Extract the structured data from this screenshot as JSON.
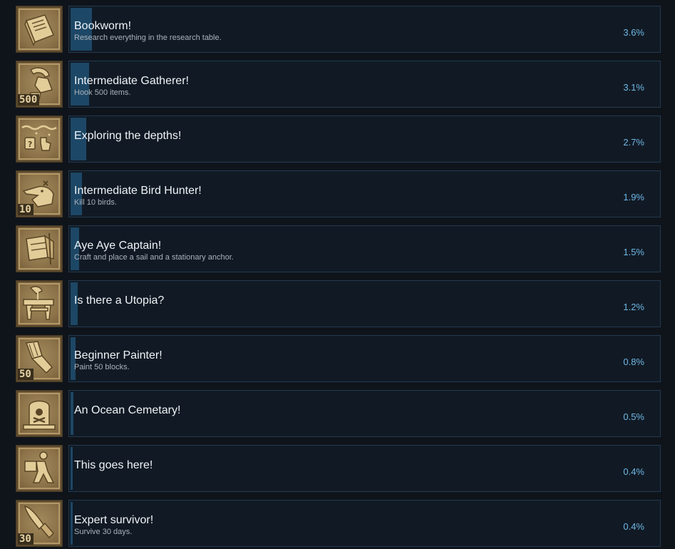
{
  "achievements": [
    {
      "title": "Bookworm!",
      "description": "Research everything in the research table.",
      "percent": "3.6%",
      "percent_value": 3.6,
      "icon": "book-icon",
      "count": ""
    },
    {
      "title": "Intermediate Gatherer!",
      "description": "Hook 500 items.",
      "percent": "3.1%",
      "percent_value": 3.1,
      "icon": "hook-icon",
      "count": "500"
    },
    {
      "title": "Exploring the depths!",
      "description": "",
      "percent": "2.7%",
      "percent_value": 2.7,
      "icon": "underwater-icon",
      "count": ""
    },
    {
      "title": "Intermediate Bird Hunter!",
      "description": "Kill 10 birds.",
      "percent": "1.9%",
      "percent_value": 1.9,
      "icon": "seagull-icon",
      "count": "10"
    },
    {
      "title": "Aye Aye Captain!",
      "description": "Craft and place a sail and a stationary anchor.",
      "percent": "1.5%",
      "percent_value": 1.5,
      "icon": "sail-icon",
      "count": ""
    },
    {
      "title": "Is there a Utopia?",
      "description": "",
      "percent": "1.2%",
      "percent_value": 1.2,
      "icon": "radio-tower-icon",
      "count": ""
    },
    {
      "title": "Beginner Painter!",
      "description": "Paint 50 blocks.",
      "percent": "0.8%",
      "percent_value": 0.8,
      "icon": "paintbrush-icon",
      "count": "50"
    },
    {
      "title": "An Ocean Cemetary!",
      "description": "",
      "percent": "0.5%",
      "percent_value": 0.5,
      "icon": "gravestone-icon",
      "count": ""
    },
    {
      "title": "This goes here!",
      "description": "",
      "percent": "0.4%",
      "percent_value": 0.4,
      "icon": "person-carrying-box-icon",
      "count": ""
    },
    {
      "title": "Expert survivor!",
      "description": "Survive 30 days.",
      "percent": "0.4%",
      "percent_value": 0.4,
      "icon": "machete-icon",
      "count": "30"
    }
  ],
  "colors": {
    "background": "#0f141b",
    "panel": "#111a24",
    "panel_border": "#22394e",
    "progress_fill": "#1d4766",
    "percent_text": "#6fb7e6",
    "icon_gold": "#d9c08a"
  }
}
